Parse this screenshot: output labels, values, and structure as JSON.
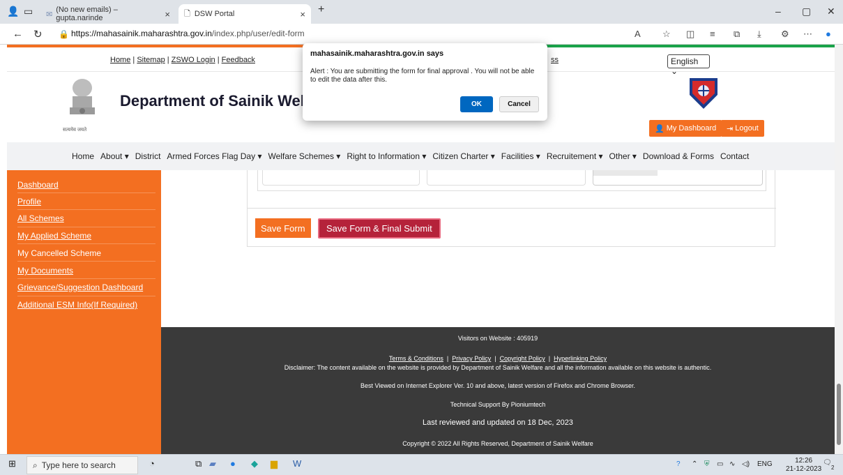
{
  "browser": {
    "tabs": [
      {
        "label": "(No new emails) – gupta.narinde",
        "close": "×"
      },
      {
        "label": "DSW Portal",
        "close": "×"
      }
    ],
    "new_tab": "+",
    "url_host": "https://mahasainik.maharashtra.gov.in",
    "url_path": "/index.php/user/edit-form",
    "window_controls": [
      "–",
      "▢",
      "✕"
    ]
  },
  "header": {
    "top_links": [
      "Home",
      "Sitemap",
      "ZSWO Login",
      "Feedback"
    ],
    "access_link": "ss",
    "language": "English ⌄",
    "emblem_caption": "सत्यमेव जयते",
    "site_title": "Department of Sainik Wel",
    "dashboard_button": "My Dashboard",
    "logout_button": "Logout"
  },
  "nav": {
    "items": [
      "Home",
      "About ▾",
      "District",
      "Armed Forces Flag Day ▾",
      "Welfare Schemes ▾",
      "Right to Information ▾",
      "Citizen Charter ▾",
      "Facilities ▾",
      "Recruitement ▾",
      "Other ▾",
      "Download & Forms",
      "Contact"
    ]
  },
  "sidebar": {
    "items": [
      {
        "label": "Dashboard",
        "underline": true
      },
      {
        "label": "Profile",
        "underline": true
      },
      {
        "label": "All Schemes",
        "underline": true
      },
      {
        "label": "My Applied Scheme",
        "underline": true
      },
      {
        "label": "My Cancelled Scheme",
        "underline": false
      },
      {
        "label": "My Documents",
        "underline": true
      },
      {
        "label": "Grievance/Suggestion Dashboard",
        "underline": true
      },
      {
        "label": "Additional ESM Info(If Required)",
        "underline": true
      }
    ]
  },
  "form": {
    "save_button": "Save Form",
    "final_submit_button": "Save Form & Final Submit"
  },
  "footer": {
    "visitors": "Visitors on Website : 405919",
    "links": [
      "Terms & Conditions",
      "Privacy Policy",
      "Copyright Policy",
      "Hyperlinking Policy"
    ],
    "separator": "|",
    "disclaimer": "Disclaimer: The content available on the website is provided by Department of Sainik Welfare and all the information available on this website is authentic.",
    "best_viewed": "Best Viewed on Internet Explorer Ver. 10 and above, latest version of Firefox and Chrome Browser.",
    "support": "Technical Support By Pioniumtech",
    "last_reviewed": "Last reviewed and updated on 18 Dec, 2023",
    "copyright": "Copyright © 2022 All Rights Reserved, Department of Sainik Welfare"
  },
  "dialog": {
    "title": "mahasainik.maharashtra.gov.in says",
    "message": "Alert : You are submitting the form for final approval . You will not be able to edit the data after this.",
    "ok": "OK",
    "cancel": "Cancel"
  },
  "taskbar": {
    "search_placeholder": "Type here to search",
    "lang": "ENG",
    "time": "12:26",
    "date": "21-12-2023",
    "notifications": "2"
  },
  "colors": {
    "accent_orange": "#f36f21",
    "final_submit": "#b5223a",
    "footer_bg": "#3a3a3a",
    "dialog_ok": "#0067c0"
  }
}
